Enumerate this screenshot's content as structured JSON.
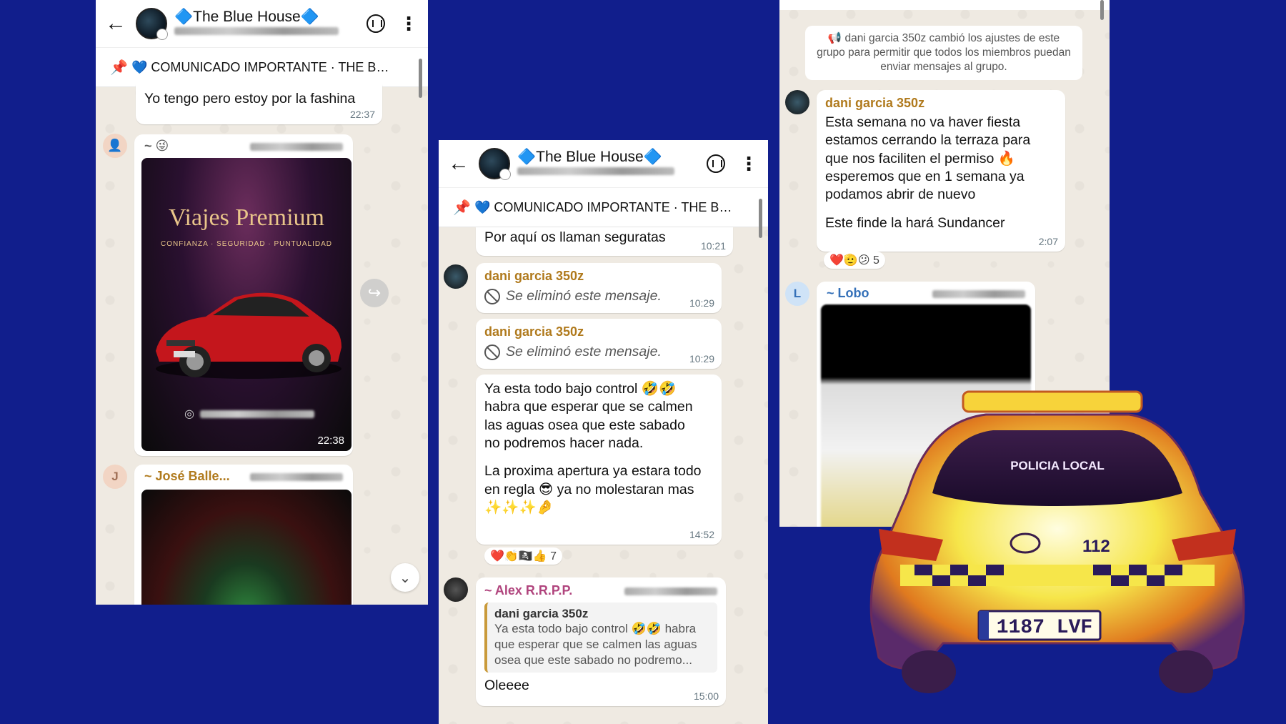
{
  "colors": {
    "background": "#111e8c",
    "chat_bg": "#efeae2",
    "sender_brown": "#b07a1d"
  },
  "panel1": {
    "header": {
      "title": "🔷The Blue House🔷"
    },
    "pinned": "💙 COMUNICADO IMPORTANTE · THE BLU...",
    "msg1": {
      "text": "Yo tengo pero estoy por la fashina",
      "time": "22:37"
    },
    "msg2": {
      "sender": "~ 😜",
      "card_title": "Viajes Premium",
      "card_subtitle": "CONFIANZA · SEGURIDAD · PUNTUALIDAD",
      "time": "22:38"
    },
    "msg3": {
      "avatar": "J",
      "sender": "~ José Balle..."
    }
  },
  "panel2": {
    "header": {
      "title": "🔷The Blue House🔷"
    },
    "pinned": "💙 COMUNICADO IMPORTANTE · THE BLU...",
    "msg1": {
      "text": "Por aquí os llaman seguratas",
      "time": "10:21"
    },
    "msg2": {
      "sender": "dani garcia 350z",
      "text": "Se eliminó este mensaje.",
      "time": "10:29"
    },
    "msg3": {
      "sender": "dani garcia 350z",
      "text": "Se eliminó este mensaje.",
      "time": "10:29"
    },
    "msg4": {
      "line1": "Ya esta todo bajo control 🤣🤣",
      "line2": "habra que esperar que se calmen",
      "line3": "las aguas osea que este sabado",
      "line4": "no podremos hacer nada.",
      "line5": "La proxima apertura ya estara todo",
      "line6": "en regla 😎 ya no molestaran mas",
      "line7": "✨✨✨🤌",
      "time": "14:52",
      "reactions": "❤️👏🏴‍☠️👍 7"
    },
    "msg5": {
      "sender": "~ Alex R.R.P.P.",
      "quote_name": "dani garcia 350z",
      "quote_text": "Ya esta todo bajo control 🤣🤣 habra que esperar que se calmen las aguas osea que este sabado no podremo...",
      "text": "Oleeee",
      "time": "15:00"
    }
  },
  "panel3": {
    "system": "📢 dani garcia 350z cambió los ajustes de este grupo para permitir que todos los miembros puedan enviar mensajes al grupo.",
    "msg1": {
      "sender": "dani garcia 350z",
      "line1": "Esta semana no va haver fiesta",
      "line2": "estamos cerrando la terraza para",
      "line3": "que nos faciliten el permiso 🔥",
      "line4": "esperemos que en 1 semana ya",
      "line5": "podamos abrir de nuevo",
      "line6": "Este finde la hará Sundancer",
      "time": "2:07",
      "reactions": "❤️🫡😕 5"
    },
    "msg2": {
      "avatar": "L",
      "sender": "~ Lobo"
    }
  },
  "police_car": {
    "label": "POLICIA LOCAL",
    "plate": "1187 LVF",
    "number": "112"
  }
}
